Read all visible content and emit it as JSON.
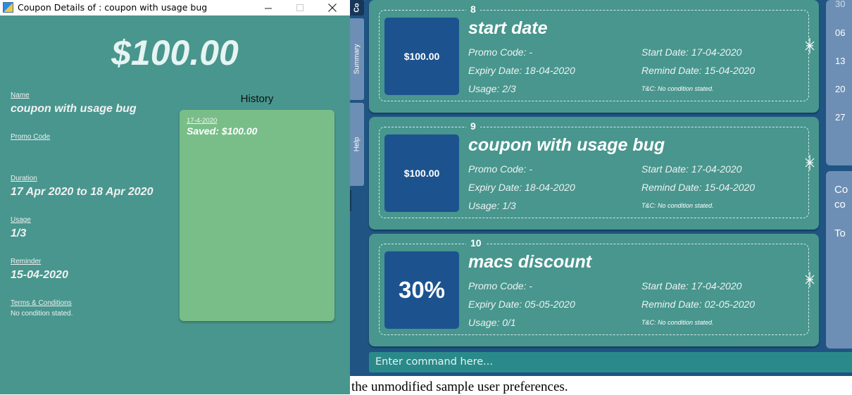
{
  "detail_window": {
    "title": "Coupon Details of : coupon with usage bug",
    "amount": "$100.00",
    "fields": {
      "name": {
        "label": "Name",
        "value": "coupon with usage bug"
      },
      "promo_code": {
        "label": "Promo Code",
        "value": ""
      },
      "duration": {
        "label": "Duration",
        "value": "17 Apr 2020 to 18 Apr 2020"
      },
      "usage": {
        "label": "Usage",
        "value": "1/3"
      },
      "reminder": {
        "label": "Reminder",
        "value": "15-04-2020"
      },
      "terms": {
        "label": "Terms & Conditions",
        "value": "No condition stated."
      }
    },
    "history": {
      "heading": "History",
      "entries": [
        {
          "date": "17-4-2020",
          "saved": "Saved: $100.00"
        }
      ]
    }
  },
  "main_app": {
    "side_tabs": [
      {
        "label": "Co"
      },
      {
        "label": "Summary"
      },
      {
        "label": "Help"
      }
    ],
    "coupons": [
      {
        "index": "8",
        "name": "start date",
        "value": "$100.00",
        "promo_code": "Promo Code: -",
        "start_date": "Start Date: 17-04-2020",
        "expiry_date": "Expiry Date: 18-04-2020",
        "remind_date": "Remind Date: 15-04-2020",
        "usage": "Usage: 2/3",
        "tnc": "T&C: No condition stated."
      },
      {
        "index": "9",
        "name": "coupon with usage bug",
        "value": "$100.00",
        "promo_code": "Promo Code: -",
        "start_date": "Start Date: 17-04-2020",
        "expiry_date": "Expiry Date: 18-04-2020",
        "remind_date": "Remind Date: 15-04-2020",
        "usage": "Usage: 1/3",
        "tnc": "T&C: No condition stated."
      },
      {
        "index": "10",
        "name": "macs discount",
        "value": "30%",
        "promo_code": "Promo Code: -",
        "start_date": "Start Date: 17-04-2020",
        "expiry_date": "Expiry Date: 05-05-2020",
        "remind_date": "Remind Date: 02-05-2020",
        "usage": "Usage: 0/1",
        "tnc": "T&C: No condition stated."
      }
    ],
    "command_placeholder": "Enter command here...",
    "calendar_days": [
      "30",
      "06",
      "13",
      "20",
      "27"
    ],
    "summary_lines": [
      "Co",
      "co",
      "To"
    ]
  },
  "console_text": "the unmodified sample user preferences.",
  "icons": {
    "app": "app-icon",
    "minimize": "minimize-icon",
    "maximize": "maximize-icon",
    "close": "close-icon",
    "archive": "archive-icon"
  }
}
